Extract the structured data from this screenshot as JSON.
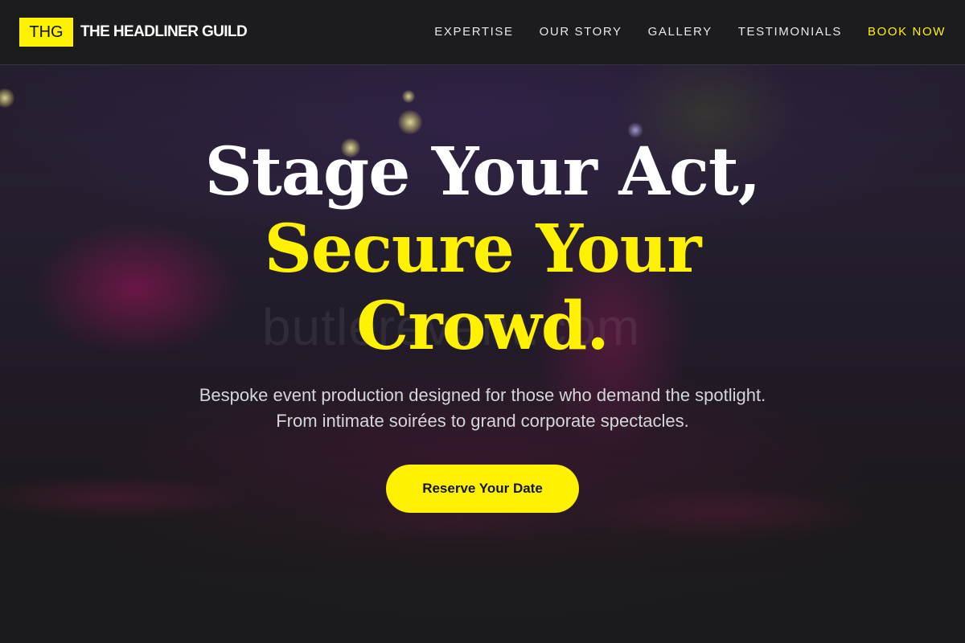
{
  "brand": {
    "badge": "THG",
    "name": "THE HEADLINER GUILD",
    "accent_color": "#fff200"
  },
  "nav": {
    "items": [
      {
        "label": "EXPERTISE"
      },
      {
        "label": "OUR STORY"
      },
      {
        "label": "GALLERY"
      },
      {
        "label": "TESTIMONIALS"
      },
      {
        "label": "BOOK NOW"
      }
    ]
  },
  "hero": {
    "headline_line1": "Stage Your Act,",
    "headline_line2": "Secure Your",
    "headline_line3": "Crowd.",
    "subtitle_line1": "Bespoke event production designed for those who demand the spotlight.",
    "subtitle_line2": "From intimate soirées to grand corporate spectacles.",
    "cta_label": "Reserve Your Date",
    "background_watermark": "butlerevent.com"
  }
}
